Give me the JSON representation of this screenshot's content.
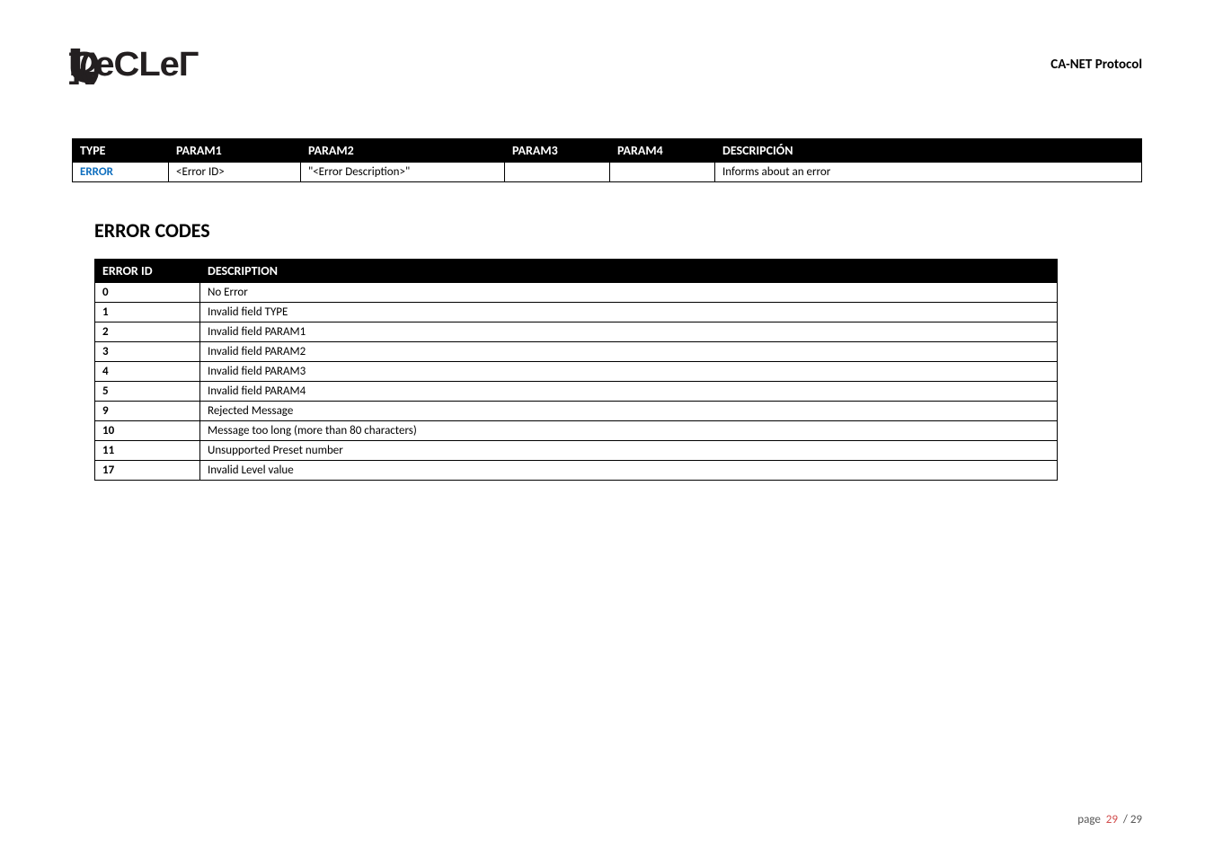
{
  "header": {
    "logo_text": "ecler",
    "doc_title": "CA-NET Protocol"
  },
  "proto_table": {
    "headers": {
      "type": "TYPE",
      "p1": "PARAM1",
      "p2": "PARAM2",
      "p3": "PARAM3",
      "p4": "PARAM4",
      "desc": "DESCRIPCIÓN"
    },
    "row": {
      "type": "ERROR",
      "p1": "<Error ID>",
      "p2": "\"<Error Description>\"",
      "p3": "",
      "p4": "",
      "desc": "Informs about an error"
    }
  },
  "section_title": "ERROR CODES",
  "codes_table": {
    "headers": {
      "id": "ERROR ID",
      "desc": "DESCRIPTION"
    },
    "rows": [
      {
        "id": "0",
        "desc": "No Error"
      },
      {
        "id": "1",
        "desc": "Invalid field TYPE"
      },
      {
        "id": "2",
        "desc": "Invalid field PARAM1"
      },
      {
        "id": "3",
        "desc": "Invalid field PARAM2"
      },
      {
        "id": "4",
        "desc": "Invalid field PARAM3"
      },
      {
        "id": "5",
        "desc": "Invalid field PARAM4"
      },
      {
        "id": "9",
        "desc": "Rejected Message"
      },
      {
        "id": "10",
        "desc": "Message too long (more than 80 characters)"
      },
      {
        "id": "11",
        "desc": "Unsupported Preset number"
      },
      {
        "id": "17",
        "desc": "Invalid Level value"
      }
    ]
  },
  "footer": {
    "label": "page",
    "current": "29",
    "sep": "/",
    "total": "29"
  }
}
